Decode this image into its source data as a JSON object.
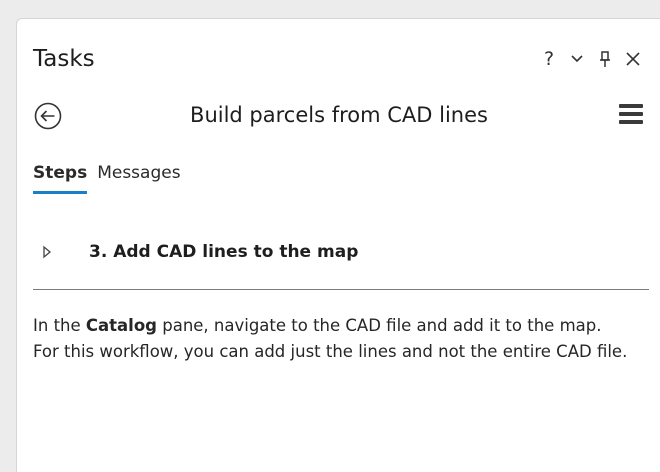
{
  "pane": {
    "title": "Tasks",
    "controls": {
      "help_label": "?",
      "menu_label": "⌄",
      "pin_label": " ",
      "close_label": "✕"
    }
  },
  "task": {
    "name": "Build parcels from CAD lines"
  },
  "tabs": [
    {
      "label": "Steps",
      "active": true
    },
    {
      "label": "Messages",
      "active": false
    }
  ],
  "step": {
    "title": "3.  Add CAD lines to the map"
  },
  "instructions": {
    "line1_pre": "In the ",
    "line1_bold": "Catalog",
    "line1_post": " pane, navigate to the CAD file and add it to the map.",
    "line2": "For this workflow, you can add just the lines and not the entire CAD file."
  },
  "colors": {
    "accent": "#1a7fc7",
    "background": "#ececec",
    "pane": "#ffffff"
  }
}
